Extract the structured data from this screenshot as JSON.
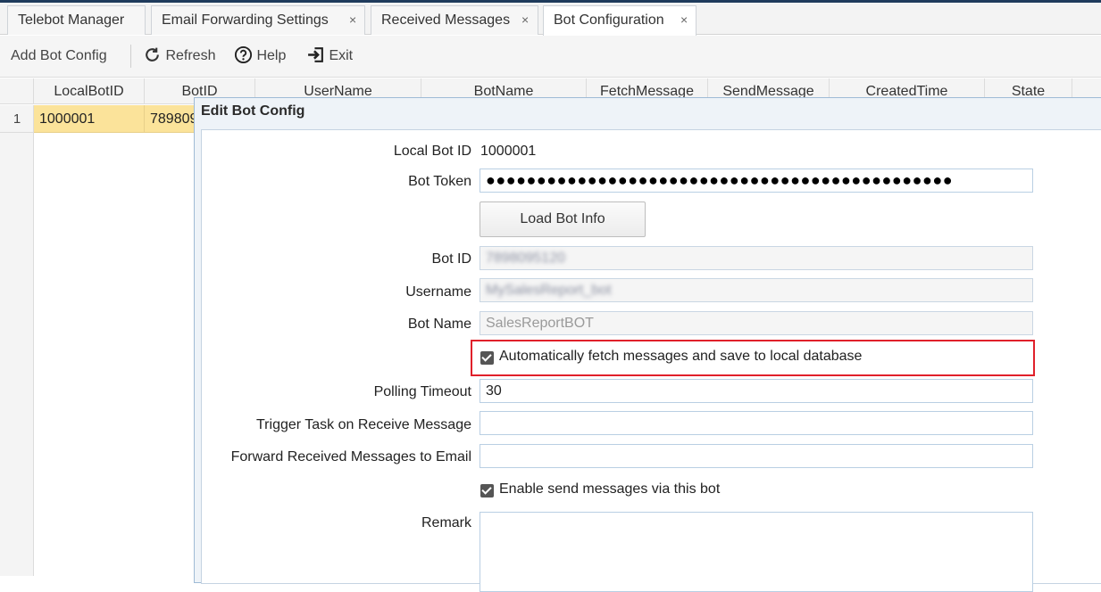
{
  "tabs": [
    {
      "label": "Telebot Manager",
      "closable": false,
      "active": false
    },
    {
      "label": "Email Forwarding Settings",
      "closable": true,
      "active": false
    },
    {
      "label": "Received Messages",
      "closable": true,
      "active": false
    },
    {
      "label": "Bot Configuration",
      "closable": true,
      "active": true
    }
  ],
  "tab_close_glyph": "×",
  "toolbar": {
    "add_label": "Add Bot Config",
    "refresh_label": "Refresh",
    "help_label": "Help",
    "exit_label": "Exit"
  },
  "grid": {
    "columns": [
      "LocalBotID",
      "BotID",
      "UserName",
      "BotName",
      "FetchMessage",
      "SendMessage",
      "CreatedTime",
      "State"
    ],
    "rows": [
      {
        "num": "1",
        "local_bot_id": "1000001",
        "bot_id": "789809"
      }
    ]
  },
  "dialog": {
    "title": "Edit Bot Config",
    "local_bot_id_label": "Local Bot ID",
    "local_bot_id_value": "1000001",
    "bot_token_label": "Bot Token",
    "bot_token_value": "●●●●●●●●●●●●●●●●●●●●●●●●●●●●●●●●●●●●●●●●●●●●●●",
    "load_bot_info_label": "Load Bot Info",
    "bot_id_label": "Bot ID",
    "bot_id_value": "7898095120",
    "username_label": "Username",
    "username_value": "MySalesReport_bot",
    "bot_name_label": "Bot Name",
    "bot_name_value": "SalesReportBOT",
    "auto_fetch_label": "Automatically fetch messages and save to local database",
    "auto_fetch_checked": true,
    "polling_timeout_label": "Polling Timeout",
    "polling_timeout_value": "30",
    "trigger_task_label": "Trigger Task on Receive Message",
    "trigger_task_value": "",
    "forward_email_label": "Forward Received Messages to Email",
    "forward_email_value": "",
    "enable_send_label": "Enable send messages via this bot",
    "enable_send_checked": true,
    "remark_label": "Remark",
    "remark_value": ""
  },
  "colors": {
    "selected_row": "#fbe39a",
    "highlight_border": "#e0202a",
    "dialog_border": "#9fbbd6"
  },
  "icons": {
    "refresh": "refresh-icon",
    "help": "help-icon",
    "exit": "exit-icon"
  }
}
